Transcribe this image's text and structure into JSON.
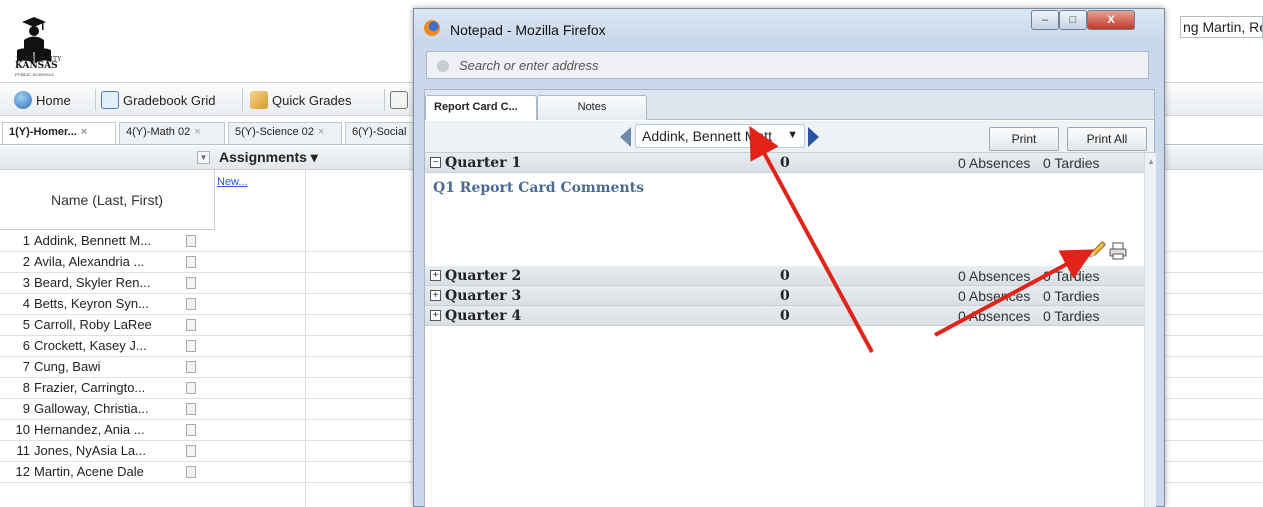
{
  "gradebook": {
    "logo": {
      "line1": "KANSAS CITY",
      "line2": "KANSAS",
      "line3": "PUBLIC SCHOOLS"
    },
    "toolbar": {
      "home": "Home",
      "gradebook_grid": "Gradebook Grid",
      "quick_grades": "Quick Grades"
    },
    "tabs": [
      {
        "label": "1(Y)-Homer...",
        "active": true
      },
      {
        "label": "4(Y)-Math 02",
        "active": false
      },
      {
        "label": "5(Y)-Science 02",
        "active": false
      },
      {
        "label": "6(Y)-Social",
        "active": false
      }
    ],
    "assignments_header": "Assignments ▾",
    "new_link": "New...",
    "name_header": "Name (Last, First)",
    "teacher_field": "ng Martin, Re",
    "students": [
      {
        "num": "1",
        "name": "Addink, Bennett M..."
      },
      {
        "num": "2",
        "name": "Avila, Alexandria ..."
      },
      {
        "num": "3",
        "name": "Beard, Skyler Ren..."
      },
      {
        "num": "4",
        "name": "Betts, Keyron Syn..."
      },
      {
        "num": "5",
        "name": "Carroll, Roby LaRee"
      },
      {
        "num": "6",
        "name": "Crockett, Kasey J..."
      },
      {
        "num": "7",
        "name": "Cung, Bawi"
      },
      {
        "num": "8",
        "name": "Frazier, Carringto..."
      },
      {
        "num": "9",
        "name": "Galloway, Christia..."
      },
      {
        "num": "10",
        "name": "Hernandez, Ania ..."
      },
      {
        "num": "11",
        "name": "Jones, NyAsia La..."
      },
      {
        "num": "12",
        "name": "Martin, Acene Dale"
      }
    ]
  },
  "firefox": {
    "title": "Notepad - Mozilla Firefox",
    "url_placeholder": "Search or enter address",
    "window_buttons": {
      "minimize": "–",
      "maximize": "□",
      "close": "X"
    }
  },
  "notepad": {
    "tabs": [
      {
        "label": "Report Card C...",
        "active": true
      },
      {
        "label": "Notes",
        "active": false
      }
    ],
    "student_selected": "Addink, Bennett Matt",
    "print_label": "Print",
    "print_all_label": "Print All",
    "quarters": [
      {
        "label": "Quarter 1",
        "expanded": true,
        "box": "−",
        "score": "0",
        "absences": "0 Absences",
        "tardies": "0 Tardies"
      },
      {
        "label": "Quarter 2",
        "expanded": false,
        "box": "+",
        "score": "0",
        "absences": "0 Absences",
        "tardies": "0 Tardies"
      },
      {
        "label": "Quarter 3",
        "expanded": false,
        "box": "+",
        "score": "0",
        "absences": "0 Absences",
        "tardies": "0 Tardies"
      },
      {
        "label": "Quarter 4",
        "expanded": false,
        "box": "+",
        "score": "0",
        "absences": "0 Absences",
        "tardies": "0 Tardies"
      }
    ],
    "q1_comments_title": "Q1 Report Card Comments"
  },
  "colors": {
    "annotation_arrow": "#e2231a",
    "accent_blue": "#4a6a92"
  }
}
